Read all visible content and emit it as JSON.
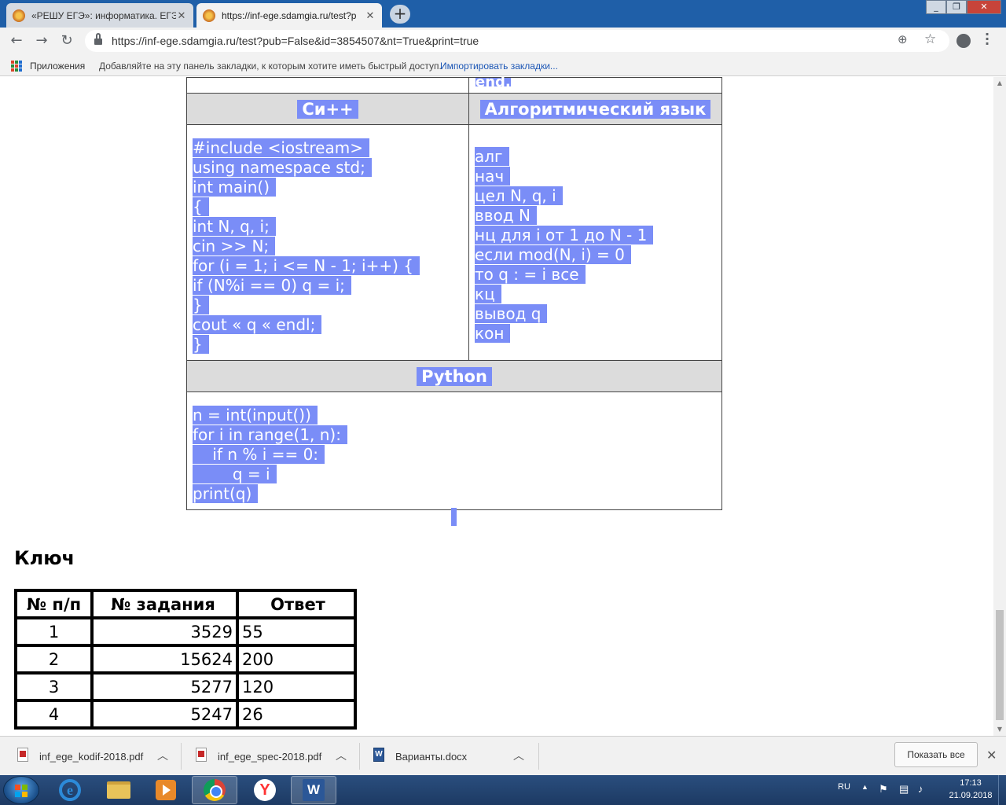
{
  "browser": {
    "tabs": [
      {
        "title": "«РЕШУ ЕГЭ»: информатика. ЕГЭ",
        "active": false
      },
      {
        "title": "https://inf-ege.sdamgia.ru/test?p",
        "active": true
      }
    ],
    "new_tab": "+",
    "url": "https://inf-ege.sdamgia.ru/test?pub=False&id=3854507&nt=True&print=true",
    "bookmarks": {
      "apps_label": "Приложения",
      "hint": "Добавляйте на эту панель закладки, к которым хотите иметь быстрый доступ.",
      "import_link": "Импортировать закладки..."
    }
  },
  "page": {
    "prev_cell_tail": "end.",
    "headers": {
      "cpp": "Си++",
      "alg": "Алгоритмический язык",
      "python": "Python"
    },
    "cpp_code": [
      "#include <iostream>",
      "using namespace std;",
      "int main()",
      "{",
      "int N, q, i;",
      "cin >> N;",
      "for (i = 1; i <= N - 1; i++) {",
      "if (N%i == 0) q = i;",
      "}",
      "cout « q « endl;",
      "}"
    ],
    "alg_code": [
      "алг",
      "нач",
      "цел N, q, i",
      "ввод N",
      "нц для i от 1 до N - 1",
      "если mod(N, i) = 0",
      "то q : = i все",
      "кц",
      "вывод q",
      "кон"
    ],
    "python_code": [
      "n = int(input())",
      "for i in range(1, n):",
      "    if n % i == 0:",
      "        q = i",
      "print(q)"
    ],
    "key": {
      "title": "Ключ",
      "columns": [
        "№ п/п",
        "№ задания",
        "Ответ"
      ],
      "rows": [
        [
          "1",
          "3529",
          "55"
        ],
        [
          "2",
          "15624",
          "200"
        ],
        [
          "3",
          "5277",
          "120"
        ],
        [
          "4",
          "5247",
          "26"
        ]
      ]
    }
  },
  "downloads": {
    "items": [
      {
        "name": "inf_ege_kodif-2018.pdf",
        "type": "pdf"
      },
      {
        "name": "inf_ege_spec-2018.pdf",
        "type": "pdf"
      },
      {
        "name": "Варианты.docx",
        "type": "docx"
      }
    ],
    "show_all": "Показать все"
  },
  "taskbar": {
    "language": "RU",
    "time": "17:13",
    "date": "21.09.2018"
  },
  "colors": {
    "selection": "#7a8df7",
    "tabstrip": "#1f5fa8",
    "header_cell": "#dcdcdc"
  }
}
